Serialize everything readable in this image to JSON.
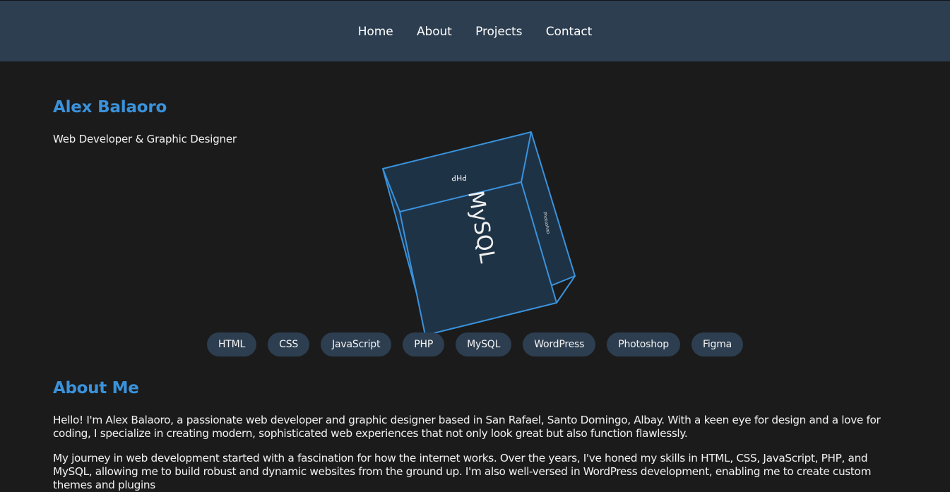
{
  "nav": {
    "items": [
      {
        "label": "Home"
      },
      {
        "label": "About"
      },
      {
        "label": "Projects"
      },
      {
        "label": "Contact"
      }
    ]
  },
  "hero": {
    "name": "Alex Balaoro",
    "tagline": "Web Developer & Graphic Designer"
  },
  "cube": {
    "face_labels": [
      "PHP",
      "MySQL",
      "Photoshop"
    ],
    "accent_color": "#3a92db",
    "face_color": "#1e3246"
  },
  "skills": [
    "HTML",
    "CSS",
    "JavaScript",
    "PHP",
    "MySQL",
    "WordPress",
    "Photoshop",
    "Figma"
  ],
  "about": {
    "title": "About Me",
    "paragraphs": [
      "Hello! I'm Alex Balaoro, a passionate web developer and graphic designer based in San Rafael, Santo Domingo, Albay. With a keen eye for design and a love for coding, I specialize in creating modern, sophisticated web experiences that not only look great but also function flawlessly.",
      "My journey in web development started with a fascination for how the internet works. Over the years, I've honed my skills in HTML, CSS, JavaScript, PHP, and MySQL, allowing me to build robust and dynamic websites from the ground up. I'm also well-versed in WordPress development, enabling me to create custom themes and plugins"
    ]
  },
  "colors": {
    "background": "#1b1b1b",
    "header": "#2d3e50",
    "accent": "#3a92db",
    "pill": "#2d3e50"
  }
}
